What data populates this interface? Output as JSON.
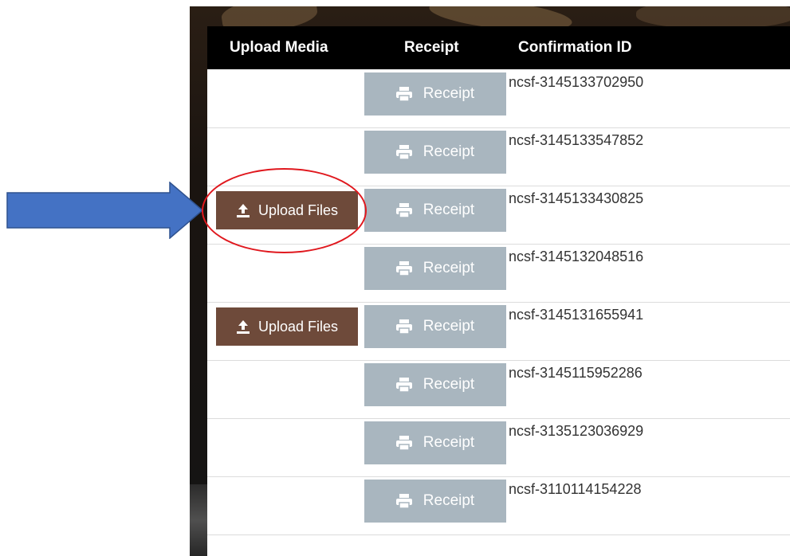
{
  "table": {
    "headers": {
      "upload_media": "Upload Media",
      "receipt": "Receipt",
      "confirmation_id": "Confirmation ID"
    },
    "rows": [
      {
        "upload_label": "",
        "receipt_label": "Receipt",
        "confirmation_id": "ncsf-3145133702950"
      },
      {
        "upload_label": "",
        "receipt_label": "Receipt",
        "confirmation_id": "ncsf-3145133547852"
      },
      {
        "upload_label": "Upload Files",
        "receipt_label": "Receipt",
        "confirmation_id": "ncsf-3145133430825"
      },
      {
        "upload_label": "",
        "receipt_label": "Receipt",
        "confirmation_id": "ncsf-3145132048516"
      },
      {
        "upload_label": "Upload Files",
        "receipt_label": "Receipt",
        "confirmation_id": "ncsf-3145131655941"
      },
      {
        "upload_label": "",
        "receipt_label": "Receipt",
        "confirmation_id": "ncsf-3145115952286"
      },
      {
        "upload_label": "",
        "receipt_label": "Receipt",
        "confirmation_id": "ncsf-3135123036929"
      },
      {
        "upload_label": "",
        "receipt_label": "Receipt",
        "confirmation_id": "ncsf-3110114154228"
      }
    ]
  },
  "annotations": {
    "arrow_color": "#4472c4",
    "ellipse_color": "#e0181e",
    "highlighted_row": 3
  },
  "colors": {
    "upload_button": "#6e4a3a",
    "receipt_button": "#a9b6bf",
    "header_bg": "#000000"
  },
  "icons": {
    "receipt": "printer-icon",
    "upload": "upload-icon"
  }
}
